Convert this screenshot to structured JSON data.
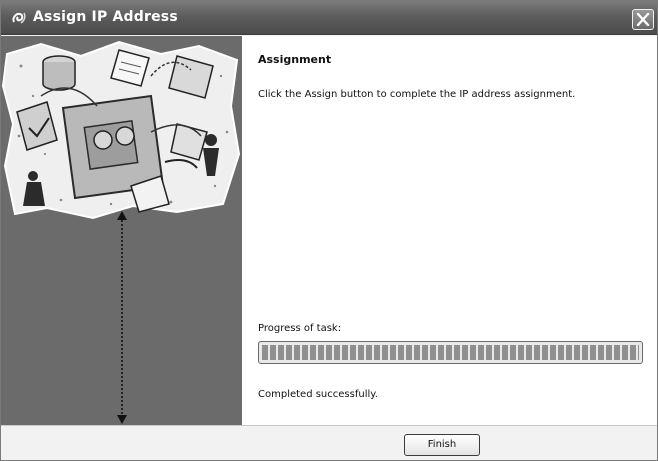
{
  "window": {
    "title": "Assign IP Address",
    "icon": "app-swirl-icon",
    "close_icon": "close-icon"
  },
  "banner": {
    "illustration": "network-collage-illustration",
    "pointer": "dotted-double-arrow"
  },
  "content": {
    "heading": "Assignment",
    "instruction": "Click the Assign button to complete the IP address assignment.",
    "progress_label": "Progress of task:",
    "progress_percent": 100,
    "status": "Completed successfully."
  },
  "footer": {
    "finish_label": "Finish"
  },
  "colors": {
    "titlebar": "#5d5d5d",
    "banner": "#6b6b6b",
    "progress_fill": "#8f8f8f"
  }
}
